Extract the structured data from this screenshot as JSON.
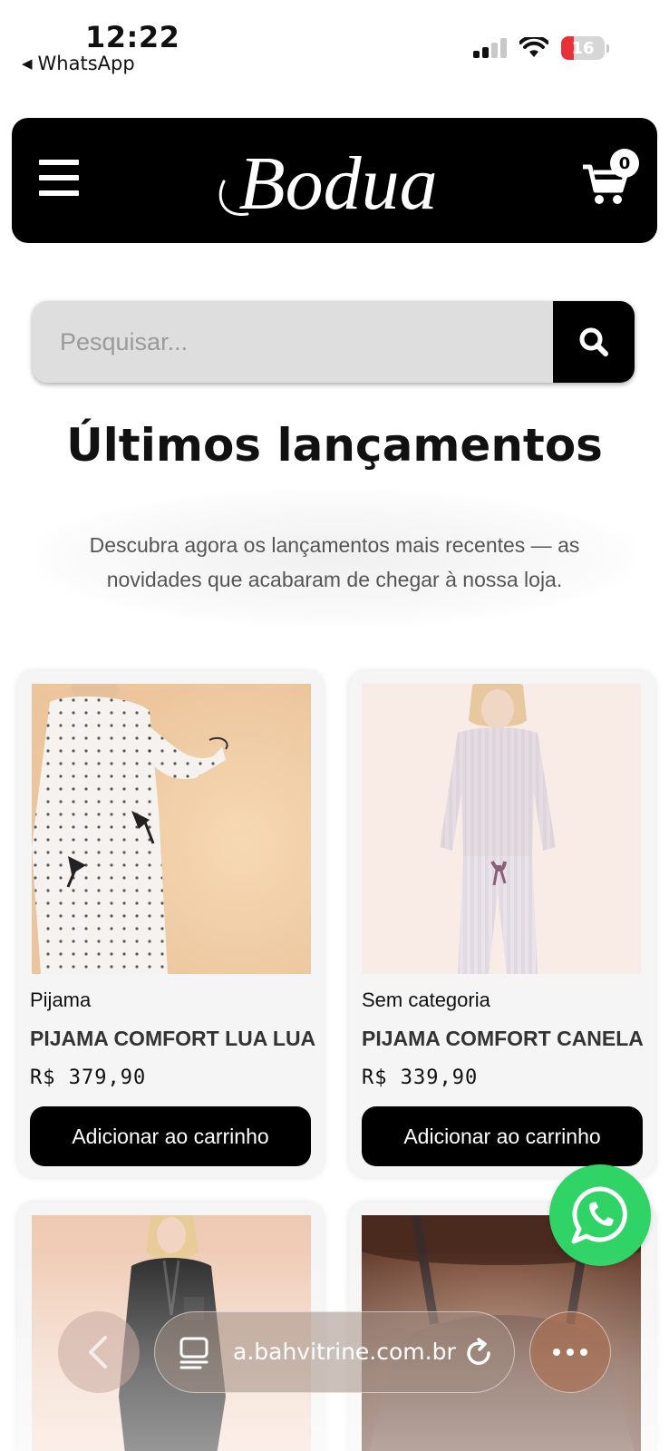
{
  "status_bar": {
    "time": "12:22",
    "back_app": "WhatsApp",
    "battery": "16"
  },
  "header": {
    "logo_text": "Bodua",
    "cart_count": "0"
  },
  "search": {
    "placeholder": "Pesquisar..."
  },
  "section": {
    "title": "Últimos lançamentos",
    "description": "Descubra agora os lançamentos mais recentes — as novidades que acabaram de chegar à nossa loja."
  },
  "products": [
    {
      "category": "Pijama",
      "name": "PIJAMA COMFORT LUA LUA",
      "price": "R$ 379,90",
      "button": "Adicionar ao carrinho",
      "image_bg": "#f2d3ae"
    },
    {
      "category": "Sem categoria",
      "name": "PIJAMA COMFORT CANELADO",
      "price": "R$ 339,90",
      "button": "Adicionar ao carrinho",
      "image_bg": "#f9ece6"
    },
    {
      "image_bg": "#efc9b2"
    },
    {
      "image_bg": "#8a5a45"
    }
  ],
  "browser": {
    "url": "a.bahvitrine.com.br"
  },
  "colors": {
    "header_bg": "#000000",
    "whatsapp_green": "#2fd366",
    "battery_low": "#e8323a"
  }
}
